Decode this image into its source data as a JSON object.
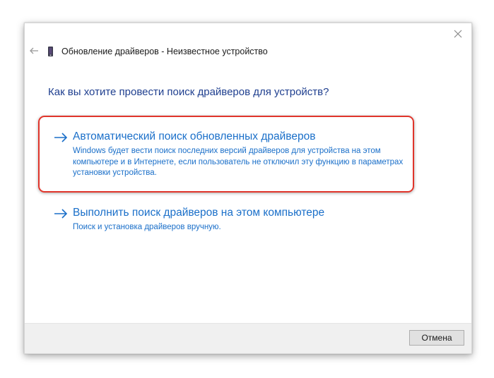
{
  "window": {
    "title": "Обновление драйверов - Неизвестное устройство",
    "close_icon": "close-icon",
    "back_icon": "back-arrow-icon",
    "device_icon": "device-icon"
  },
  "main": {
    "heading": "Как вы хотите провести поиск драйверов для устройств?",
    "options": [
      {
        "title": "Автоматический поиск обновленных драйверов",
        "description": "Windows будет вести поиск последних версий драйверов для устройства на этом компьютере и в Интернете, если пользователь не отключил эту функцию в параметрах установки устройства.",
        "highlighted": true
      },
      {
        "title": "Выполнить поиск драйверов на этом компьютере",
        "description": "Поиск и установка драйверов вручную."
      }
    ]
  },
  "footer": {
    "cancel_label": "Отмена"
  },
  "colors": {
    "link_blue": "#1a6fc9",
    "heading_blue": "#1f3f8f",
    "highlight_red": "#e0352b"
  }
}
